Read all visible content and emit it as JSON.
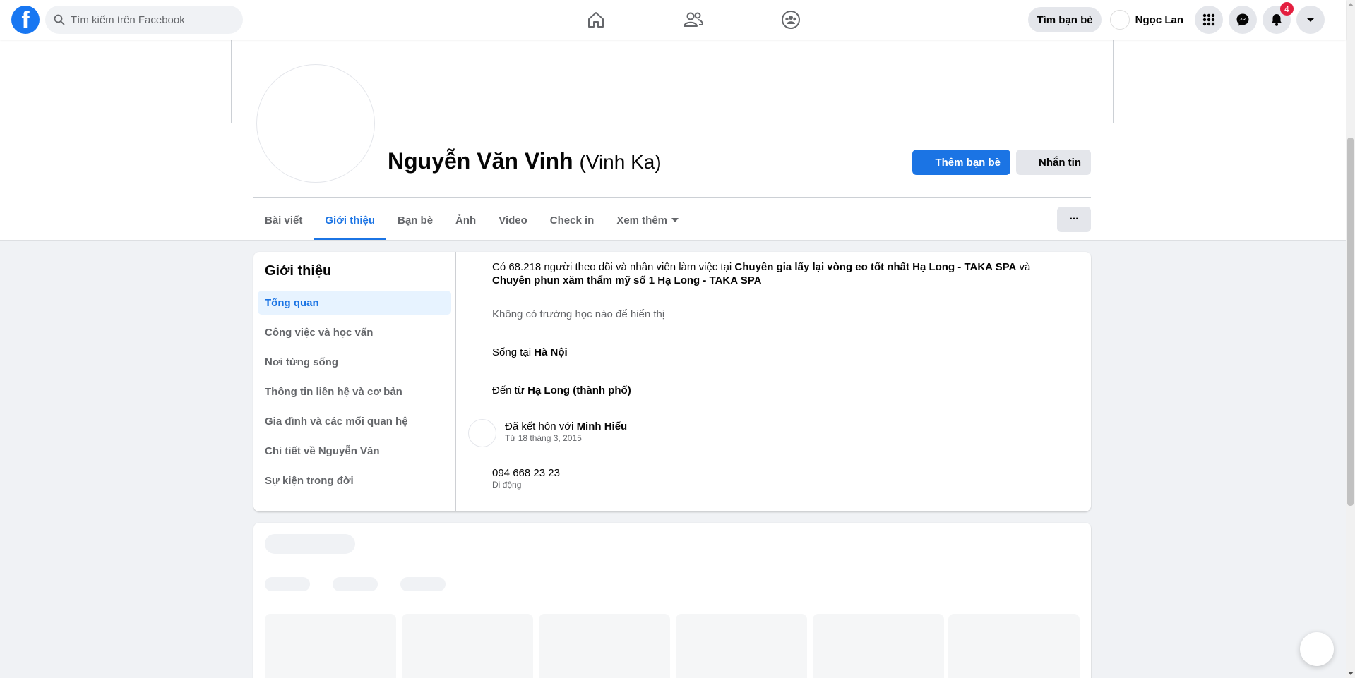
{
  "topbar": {
    "search_placeholder": "Tìm kiếm trên Facebook",
    "find_friends": "Tìm bạn bè",
    "user_name": "Ngọc Lan",
    "notification_count": "4",
    "icons": [
      "facebook-logo",
      "search-icon",
      "home-icon",
      "friends-icon",
      "groups-icon",
      "menu-grid-icon",
      "messenger-icon",
      "bell-icon",
      "account-caret-icon"
    ]
  },
  "profile": {
    "name": "Nguyễn Văn Vinh",
    "nickname": "(Vinh Ka)",
    "add_friend": "Thêm bạn bè",
    "message": "Nhắn tin"
  },
  "tabs": [
    {
      "label": "Bài viết",
      "active": false
    },
    {
      "label": "Giới thiệu",
      "active": true
    },
    {
      "label": "Bạn bè",
      "active": false
    },
    {
      "label": "Ảnh",
      "active": false
    },
    {
      "label": "Video",
      "active": false
    },
    {
      "label": "Check in",
      "active": false
    },
    {
      "label": "Xem thêm",
      "active": false
    }
  ],
  "more_options": "···",
  "about": {
    "title": "Giới thiệu",
    "sections": [
      {
        "label": "Tổng quan",
        "active": true
      },
      {
        "label": "Công việc và học vấn",
        "active": false
      },
      {
        "label": "Nơi từng sống",
        "active": false
      },
      {
        "label": "Thông tin liên hệ và cơ bản",
        "active": false
      },
      {
        "label": "Gia đình và các mối quan hệ",
        "active": false
      },
      {
        "label": "Chi tiết về Nguyễn Văn",
        "active": false
      },
      {
        "label": "Sự kiện trong đời",
        "active": false
      }
    ],
    "work": {
      "prefix": "Có 68.218 người theo dõi và nhân viên làm việc tại ",
      "place1": "Chuyên gia lấy lại vòng eo tốt nhất Hạ Long - TAKA SPA",
      "joiner": " và",
      "place2": "Chuyên phun xăm thẩm mỹ số 1 Hạ Long - TAKA SPA"
    },
    "school": "Không có trường học nào để hiển thị",
    "lives": {
      "prefix": "Sống tại ",
      "place": "Hà Nội"
    },
    "from": {
      "prefix": "Đến từ ",
      "place": "Hạ Long (thành phố)"
    },
    "relationship": {
      "prefix": "Đã kết hôn với ",
      "partner": "Minh Hiếu",
      "since": "Từ 18 tháng 3, 2015"
    },
    "phone": {
      "number": "094 668 23 23",
      "type": "Di động"
    }
  }
}
